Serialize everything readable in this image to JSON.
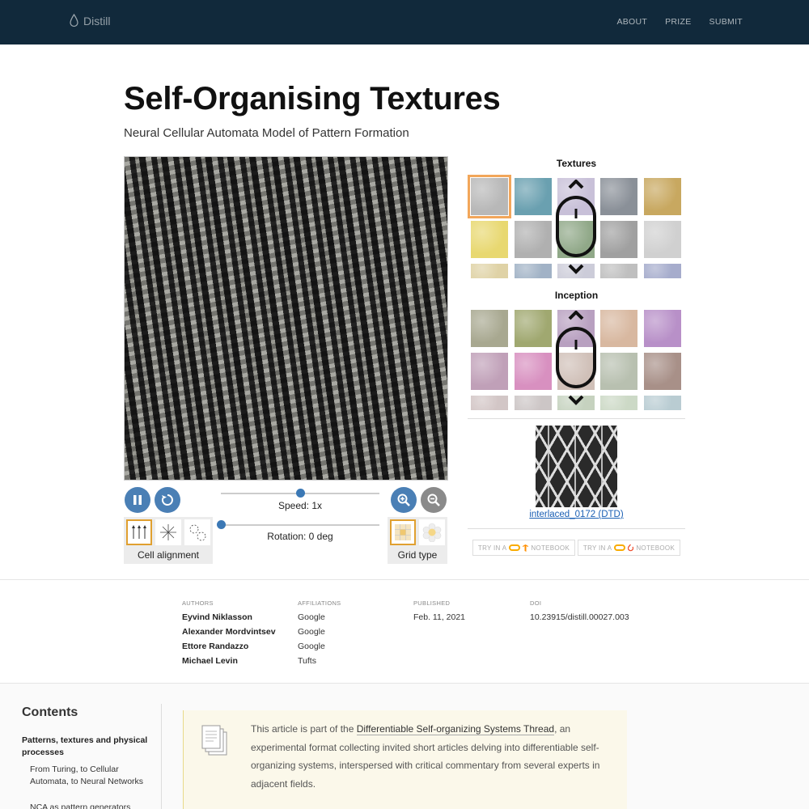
{
  "header": {
    "brand": "Distill",
    "nav": [
      "ABOUT",
      "PRIZE",
      "SUBMIT"
    ]
  },
  "article": {
    "title": "Self-Organising Textures",
    "subtitle": "Neural Cellular Automata Model of Pattern Formation"
  },
  "controls": {
    "speed_label": "Speed: 1x",
    "speed_value": 0.5,
    "rotation_label": "Rotation: 0 deg",
    "rotation_value": 0,
    "cell_alignment_label": "Cell alignment",
    "grid_type_label": "Grid type"
  },
  "gallery": {
    "textures_heading": "Textures",
    "inception_heading": "Inception",
    "selected_texture": "interlaced_0172 (DTD)",
    "texture_colors": [
      "#b8b8b8",
      "#6aa0b0",
      "#c8c0d8",
      "#8a9098",
      "#c8a860",
      "#e8d870",
      "#b0b0b0",
      "#90a888",
      "#a0a0a0",
      "#d0d0d0",
      "#d8c890",
      "#8aa0b8",
      "#c0c0d0",
      "#b0b0b0",
      "#9098c0"
    ],
    "inception_colors": [
      "#a8a890",
      "#a0a870",
      "#b8a0c0",
      "#d8b8a0",
      "#b890c8",
      "#c0a0b8",
      "#d890c0",
      "#d0c0b8",
      "#b8c0b0",
      "#a89088",
      "#c8b8b8",
      "#c0b8b8",
      "#b8c8b0",
      "#c0d0b8",
      "#a8c0c8"
    ],
    "colab_buttons": [
      {
        "prefix": "TRY IN A",
        "suffix": "NOTEBOOK",
        "icon": "tensorflow-icon"
      },
      {
        "prefix": "TRY IN A",
        "suffix": "NOTEBOOK",
        "icon": "pytorch-icon"
      }
    ]
  },
  "byline": {
    "authors_heading": "AUTHORS",
    "affiliations_heading": "AFFILIATIONS",
    "published_heading": "PUBLISHED",
    "doi_heading": "DOI",
    "authors": [
      "Eyvind Niklasson",
      "Alexander Mordvintsev",
      "Ettore Randazzo",
      "Michael Levin"
    ],
    "affiliations": [
      "Google",
      "Google",
      "Google",
      "Tufts"
    ],
    "published": "Feb. 11, 2021",
    "doi": "10.23915/distill.00027.003"
  },
  "contents": {
    "title": "Contents",
    "main_item": "Patterns, textures and physical processes",
    "sub_items": [
      "From Turing, to Cellular Automata, to Neural Networks",
      "NCA as pattern generators"
    ]
  },
  "thread_note": {
    "before": "This article is part of the ",
    "link": "Differentiable Self-organizing Systems Thread",
    "after": ", an experimental format collecting invited short articles delving into differentiable self-organizing systems, interspersed with critical commentary from several experts in adjacent fields."
  }
}
